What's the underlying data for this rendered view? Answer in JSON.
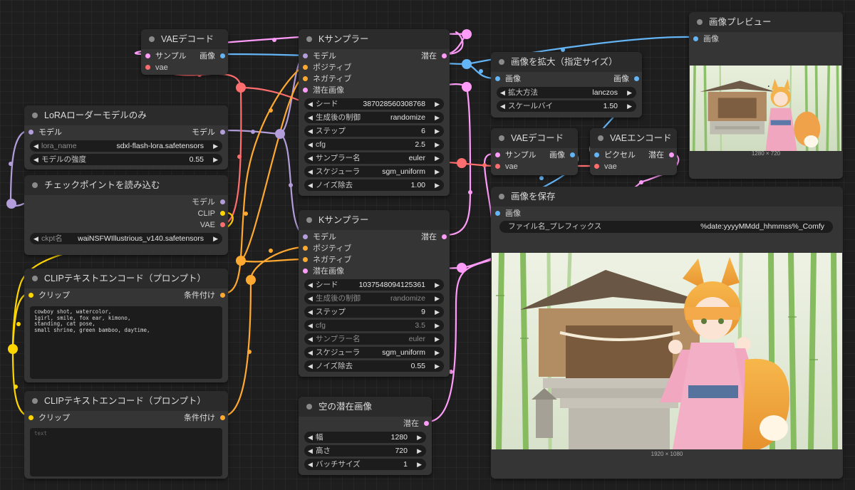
{
  "colors": {
    "model": "#b39ddb",
    "clip": "#ffd500",
    "vae": "#ff6e6e",
    "latent": "#ff9cf9",
    "image": "#64b5f6",
    "conditioning": "#ffa931"
  },
  "vae_decode_top": {
    "title": "VAEデコード",
    "in_samples": "サンプル",
    "in_vae": "vae",
    "out_image": "画像"
  },
  "lora_loader": {
    "title": "LoRAローダーモデルのみ",
    "in_model": "モデル",
    "out_model": "モデル",
    "w_lora_name_label": "lora_name",
    "w_lora_name_value": "sdxl-flash-lora.safetensors",
    "w_strength_label": "モデルの強度",
    "w_strength_value": "0.55"
  },
  "checkpoint": {
    "title": "チェックポイントを読み込む",
    "out_model": "モデル",
    "out_clip": "CLIP",
    "out_vae": "VAE",
    "w_ckpt_label": "ckpt名",
    "w_ckpt_value": "waiNSFWIllustrious_v140.safetensors"
  },
  "clip_text_1": {
    "title": "CLIPテキストエンコード（プロンプト）",
    "in_clip": "クリップ",
    "out_cond": "条件付け",
    "lines": [
      "cowboy shot, watercolor,",
      "1girl, smile, fox ear, kimono,",
      "standing, cat pose,",
      "small shrine, green bamboo, daytime,"
    ]
  },
  "clip_text_2": {
    "title": "CLIPテキストエンコード（プロンプト）",
    "in_clip": "クリップ",
    "out_cond": "条件付け",
    "placeholder": "text"
  },
  "ksampler_1": {
    "title": "Kサンプラー",
    "in_model": "モデル",
    "in_positive": "ポジティブ",
    "in_negative": "ネガティブ",
    "in_latent": "潜在画像",
    "out_latent": "潜在",
    "widgets": [
      {
        "label": "シード",
        "value": "387028560308768",
        "dim": false
      },
      {
        "label": "生成後の制御",
        "value": "randomize",
        "dim": false
      },
      {
        "label": "ステップ",
        "value": "6",
        "dim": false
      },
      {
        "label": "cfg",
        "value": "2.5",
        "dim": false
      },
      {
        "label": "サンプラー名",
        "value": "euler",
        "dim": false
      },
      {
        "label": "スケジューラ",
        "value": "sgm_uniform",
        "dim": false
      },
      {
        "label": "ノイズ除去",
        "value": "1.00",
        "dim": false
      }
    ]
  },
  "ksampler_2": {
    "title": "Kサンプラー",
    "in_model": "モデル",
    "in_positive": "ポジティブ",
    "in_negative": "ネガティブ",
    "in_latent": "潜在画像",
    "out_latent": "潜在",
    "widgets": [
      {
        "label": "シード",
        "value": "1037548094125361",
        "dim": false
      },
      {
        "label": "生成後の制御",
        "value": "randomize",
        "dim": true
      },
      {
        "label": "ステップ",
        "value": "9",
        "dim": false
      },
      {
        "label": "cfg",
        "value": "3.5",
        "dim": true
      },
      {
        "label": "サンプラー名",
        "value": "euler",
        "dim": true
      },
      {
        "label": "スケジューラ",
        "value": "sgm_uniform",
        "dim": false
      },
      {
        "label": "ノイズ除去",
        "value": "0.55",
        "dim": false
      }
    ]
  },
  "empty_latent": {
    "title": "空の潜在画像",
    "out_latent": "潜在",
    "widgets": [
      {
        "label": "幅",
        "value": "1280"
      },
      {
        "label": "高さ",
        "value": "720"
      },
      {
        "label": "バッチサイズ",
        "value": "1"
      }
    ]
  },
  "upscale": {
    "title": "画像を拡大（指定サイズ）",
    "in_image": "画像",
    "out_image": "画像",
    "widgets": [
      {
        "label": "拡大方法",
        "value": "lanczos"
      },
      {
        "label": "スケールバイ",
        "value": "1.50"
      }
    ]
  },
  "vae_decode_2": {
    "title": "VAEデコード",
    "in_samples": "サンプル",
    "in_vae": "vae",
    "out_image": "画像"
  },
  "vae_encode": {
    "title": "VAEエンコード",
    "in_pixels": "ピクセル",
    "in_vae": "vae",
    "out_latent": "潜在"
  },
  "preview": {
    "title": "画像プレビュー",
    "in_image": "画像",
    "caption": "1280 × 720"
  },
  "save_image": {
    "title": "画像を保存",
    "in_image": "画像",
    "w_prefix_label": "ファイル名_プレフィックス",
    "w_prefix_value": "%date:yyyyMMdd_hhmmss%_Comfy",
    "caption": "1920 × 1080"
  }
}
